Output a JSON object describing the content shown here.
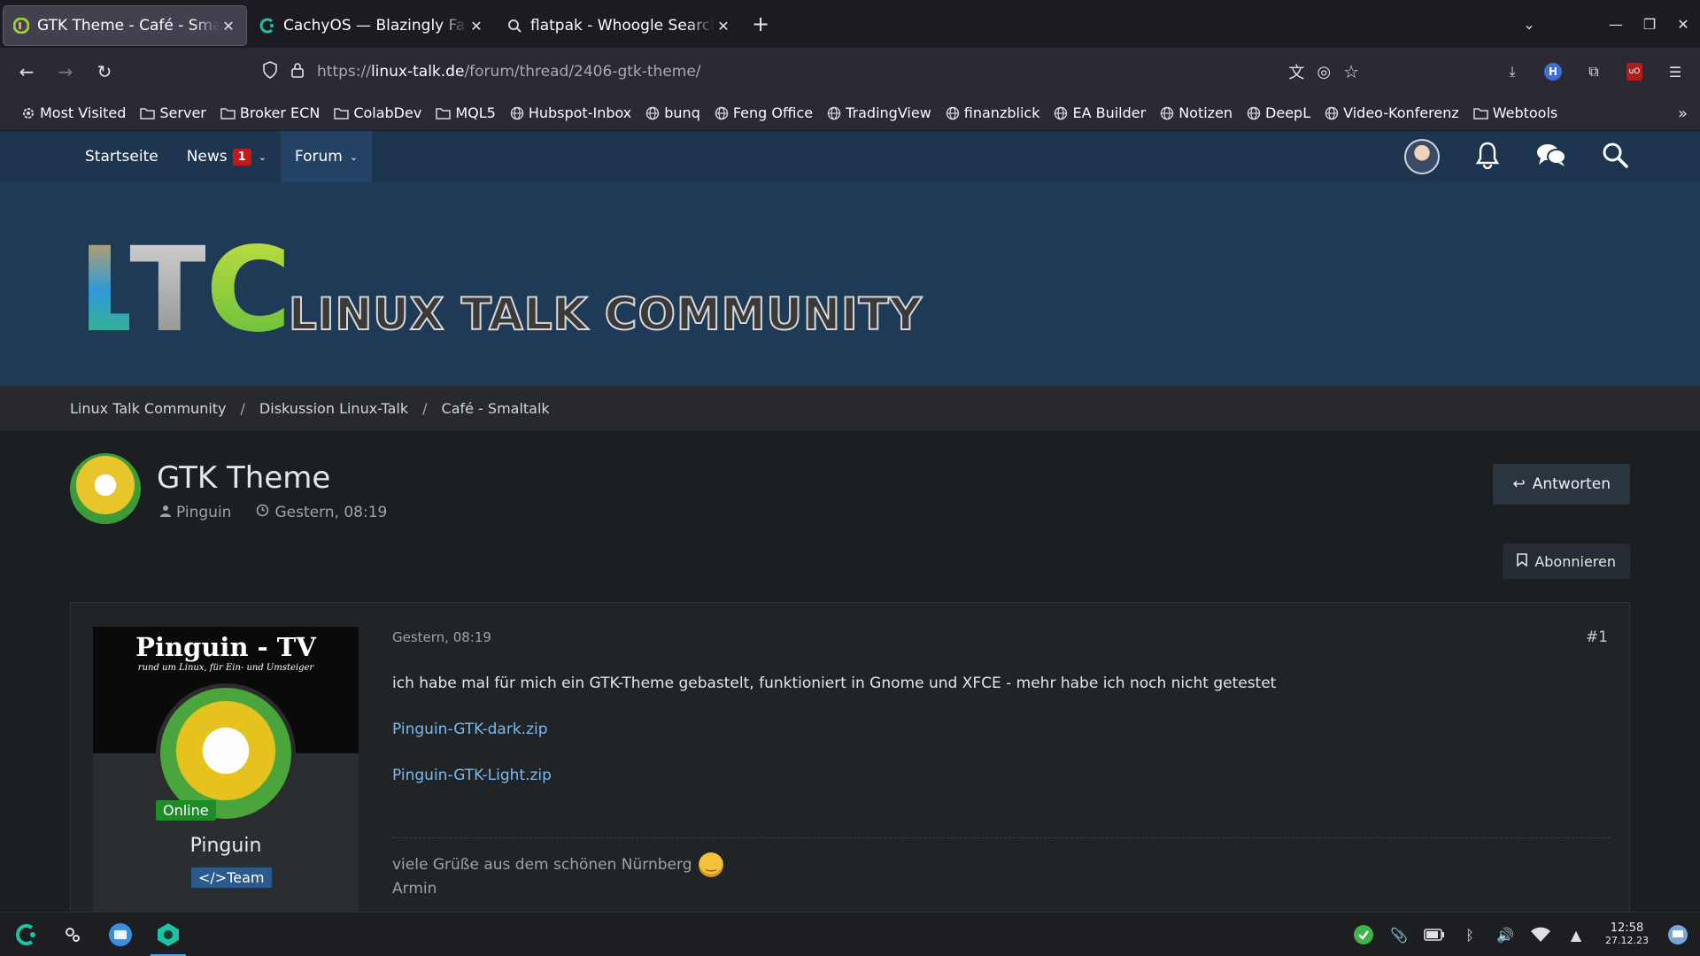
{
  "browser": {
    "tabs": [
      {
        "title": "GTK Theme - Café - Smaltalk",
        "active": true,
        "favicon": "ltc-favicon-icon"
      },
      {
        "title": "CachyOS — Blazingly Fast",
        "active": false,
        "favicon": "cachyos-icon"
      },
      {
        "title": "flatpak - Whoogle Search",
        "active": false,
        "favicon": "search-icon"
      }
    ],
    "url": {
      "scheme": "https://",
      "host": "linux-talk.de",
      "path": "/forum/thread/2406-gtk-theme/"
    },
    "bookmarks": [
      {
        "label": "Most Visited",
        "icon": "gear-icon"
      },
      {
        "label": "Server",
        "icon": "folder-icon"
      },
      {
        "label": "Broker ECN",
        "icon": "folder-icon"
      },
      {
        "label": "ColabDev",
        "icon": "folder-icon"
      },
      {
        "label": "MQL5",
        "icon": "folder-icon"
      },
      {
        "label": "Hubspot-Inbox",
        "icon": "globe-icon"
      },
      {
        "label": "bunq",
        "icon": "globe-icon"
      },
      {
        "label": "Feng Office",
        "icon": "globe-icon"
      },
      {
        "label": "TradingView",
        "icon": "globe-icon"
      },
      {
        "label": "finanzblick",
        "icon": "globe-icon"
      },
      {
        "label": "EA Builder",
        "icon": "globe-icon"
      },
      {
        "label": "Notizen",
        "icon": "globe-icon"
      },
      {
        "label": "DeepL",
        "icon": "globe-icon"
      },
      {
        "label": "Video-Konferenz",
        "icon": "globe-icon"
      },
      {
        "label": "Webtools",
        "icon": "folder-icon"
      }
    ]
  },
  "site": {
    "menu": {
      "home": "Startseite",
      "news": "News",
      "news_badge": "1",
      "forum": "Forum"
    },
    "logo": {
      "letters": [
        "L",
        "T",
        "C"
      ],
      "text": "LINUX TALK COMMUNITY"
    },
    "breadcrumb": [
      "Linux Talk Community",
      "Diskussion Linux-Talk",
      "Café - Smaltalk"
    ],
    "thread": {
      "title": "GTK Theme",
      "author": "Pinguin",
      "date": "Gestern, 08:19",
      "reply_label": "Antworten",
      "subscribe_label": "Abonnieren"
    },
    "post": {
      "banner_title": "Pinguin - TV",
      "banner_subtitle": "rund um Linux, für Ein- und Umsteiger",
      "status": "Online",
      "username": "Pinguin",
      "rank": "</>Team",
      "date": "Gestern, 08:19",
      "number": "#1",
      "text": "ich habe mal für mich ein GTK-Theme gebastelt, funktioniert in Gnome und XFCE - mehr habe ich noch nicht getestet",
      "attachments": [
        "Pinguin-GTK-dark.zip",
        "Pinguin-GTK-Light.zip"
      ],
      "signature_line1": "viele Grüße aus dem schönen Nürnberg",
      "signature_line2": "Armin"
    }
  },
  "taskbar": {
    "time": "12:58",
    "date": "27.12.23"
  },
  "colors": {
    "site_nav": "#1e3550",
    "banner": "#1f3a56",
    "link": "#7bb8ee",
    "badge": "#c61818",
    "online": "#1f8c2a"
  }
}
